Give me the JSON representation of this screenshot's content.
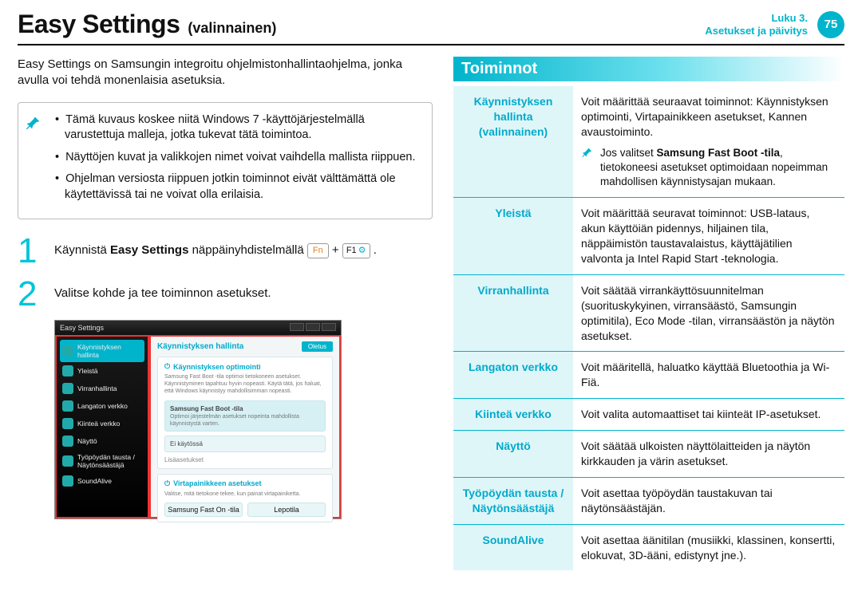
{
  "header": {
    "title_main": "Easy Settings",
    "title_sub": "(valinnainen)",
    "chapter_line1": "Luku 3.",
    "chapter_line2": "Asetukset ja päivitys",
    "page_number": "75"
  },
  "intro": "Easy Settings on Samsungin integroitu ohjelmistonhallintaohjelma, jonka avulla voi tehdä monenlaisia asetuksia.",
  "note_bullets": [
    "Tämä kuvaus koskee niitä Windows 7 -käyttöjärjestelmällä varustettuja malleja, jotka tukevat tätä toimintoa.",
    "Näyttöjen kuvat ja valikkojen nimet voivat vaihdella mallista riippuen.",
    "Ohjelman versiosta riippuen jotkin toiminnot eivät välttämättä ole käytettävissä tai ne voivat olla erilaisia."
  ],
  "steps": {
    "s1_pre": "Käynnistä ",
    "s1_bold": "Easy Settings",
    "s1_post": " näppäinyhdistelmällä ",
    "key_fn": "Fn",
    "key_plus": "+",
    "key_f1": "F1",
    "s2": "Valitse kohde ja tee toiminnon asetukset."
  },
  "screenshot": {
    "window_title": "Easy Settings",
    "sidebar": [
      "Käynnistyksen hallinta",
      "Yleistä",
      "Virranhallinta",
      "Langaton verkko",
      "Kiinteä verkko",
      "Näyttö",
      "Työpöydän tausta  / Näytönsäästäjä",
      "SoundAlive"
    ],
    "breadcrumb": "Käynnistyksen hallinta",
    "default_btn": "Oletus",
    "card1_title": "Käynnistyksen optimointi",
    "card1_desc": "Samsung Fast Boot -tila optimoi tietokoneen asetukset. Käynnistyminen tapahtuu hyvin nopeasti. Käytä tätä, jos haluat, että Windows käynnistyy mahdollisimman nopeasti.",
    "opt1": "Samsung Fast Boot -tila",
    "opt1_sub": "Optimoi järjestelmän asetukset nopeinta mahdollista käynnistystä varten.",
    "opt2": "Ei käytössä",
    "more": "Lisäasetukset",
    "card2_title": "Virtapainikkeen asetukset",
    "card2_desc": "Valitse, mitä tietokone tekee, kun painat virtapainiketta.",
    "pill1": "Samsung Fast On -tila",
    "pill2": "Lepotila"
  },
  "section_title": "Toiminnot",
  "features": [
    {
      "label": "Käynnistyksen hallinta (valinnainen)",
      "desc_pre": "Voit määrittää seuraavat toiminnot: Käynnistyksen optimointi, Virtapainikkeen asetukset, Kannen avaustoiminto.",
      "note_pre": "Jos valitset ",
      "note_bold": "Samsung Fast Boot -tila",
      "note_post": ", tietokoneesi asetukset optimoidaan nopeimman mahdollisen käynnistysajan mukaan."
    },
    {
      "label": "Yleistä",
      "desc": "Voit määrittää seuravat toiminnot: USB-lataus, akun käyttöiän pidennys, hiljainen tila, näppäimistön taustavalaistus, käyttäjätilien valvonta ja Intel Rapid Start -teknologia."
    },
    {
      "label": "Virranhallinta",
      "desc": "Voit säätää virrankäyttösuunnitelman (suorituskykyinen, virransäästö, Samsungin optimitila), Eco Mode -tilan, virransäästön ja näytön asetukset."
    },
    {
      "label": "Langaton verkko",
      "desc": "Voit määritellä, haluatko käyttää Bluetoothia ja Wi-Fiä."
    },
    {
      "label": "Kiinteä verkko",
      "desc": "Voit valita automaattiset tai kiinteät IP-asetukset."
    },
    {
      "label": "Näyttö",
      "desc": "Voit säätää ulkoisten näyttölaitteiden ja näytön kirkkauden ja värin asetukset."
    },
    {
      "label": "Työpöydän tausta / Näytönsäästäjä",
      "desc": "Voit asettaa työpöydän taustakuvan tai näytönsäästäjän."
    },
    {
      "label": "SoundAlive",
      "desc": "Voit asettaa äänitilan (musiikki, klassinen, konsertti, elokuvat, 3D-ääni, edistynyt jne.)."
    }
  ]
}
